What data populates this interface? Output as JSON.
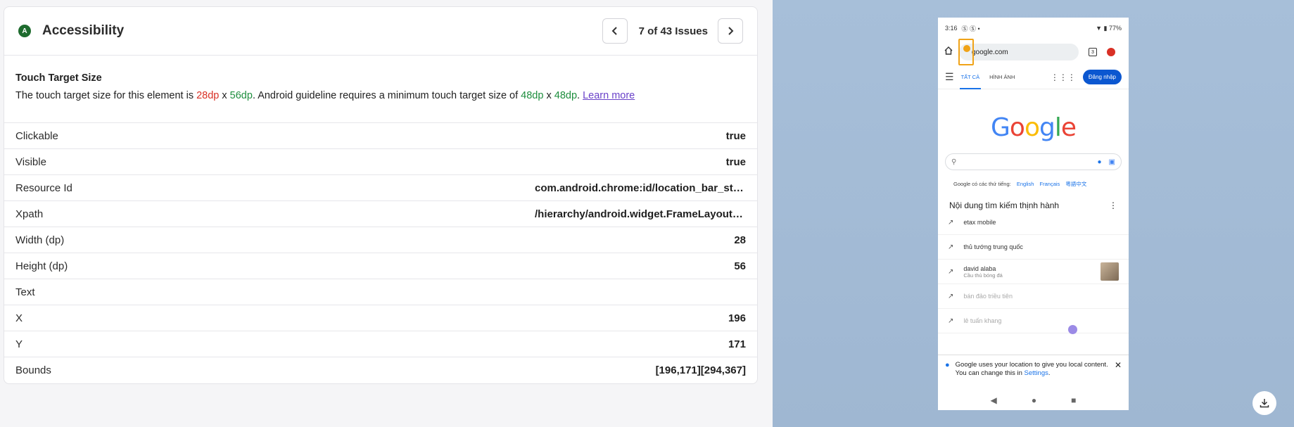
{
  "panel": {
    "badge": "A",
    "title": "Accessibility",
    "issue_counter": "7 of 43 Issues"
  },
  "issue": {
    "title": "Touch Target Size",
    "desc_prefix": "The touch target size for this element is ",
    "width_value": "28dp",
    "x_sep": " x ",
    "height_value": "56dp",
    "desc_middle": ". Android guideline requires a minimum touch target size of ",
    "min_w": "48dp",
    "x_sep2": " x ",
    "min_h": "48dp",
    "period": ". ",
    "learn_more": "Learn more"
  },
  "properties": [
    {
      "key": "Clickable",
      "value": "true"
    },
    {
      "key": "Visible",
      "value": "true"
    },
    {
      "key": "Resource Id",
      "value": "com.android.chrome:id/location_bar_status_icon"
    },
    {
      "key": "Xpath",
      "value": "/hierarchy/android.widget.FrameLayout/android.widget.LinearLayout"
    },
    {
      "key": "Width (dp)",
      "value": "28"
    },
    {
      "key": "Height (dp)",
      "value": "56"
    },
    {
      "key": "Text",
      "value": ""
    },
    {
      "key": "X",
      "value": "196"
    },
    {
      "key": "Y",
      "value": "171"
    },
    {
      "key": "Bounds",
      "value": "[196,171][294,367]"
    }
  ],
  "phone": {
    "time": "3:16",
    "status_icons": "Ⓢ Ⓢ •",
    "battery": "▼ ▮ 77%",
    "url": "google.com",
    "tabs_count": "3",
    "tab_all": "TẤT CẢ",
    "tab_images": "HÌNH ẢNH",
    "login": "Đăng nhập",
    "logo": [
      "G",
      "o",
      "o",
      "g",
      "l",
      "e"
    ],
    "lang_prefix": "Google có các thứ tiếng:",
    "langs": [
      "English",
      "Français",
      "粵語中文"
    ],
    "trend_title": "Nội dung tìm kiếm thịnh hành",
    "trends": [
      {
        "text": "etax mobile",
        "sub": ""
      },
      {
        "text": "thủ tướng trung quốc",
        "sub": ""
      },
      {
        "text": "david alaba",
        "sub": "Cầu thủ bóng đá"
      },
      {
        "text": "bán đảo triều tiên",
        "sub": ""
      },
      {
        "text": "lê tuấn khang",
        "sub": ""
      }
    ],
    "banner_text": "Google uses your location to give you local content. You can change this in ",
    "banner_link": "Settings",
    "banner_period": "."
  }
}
